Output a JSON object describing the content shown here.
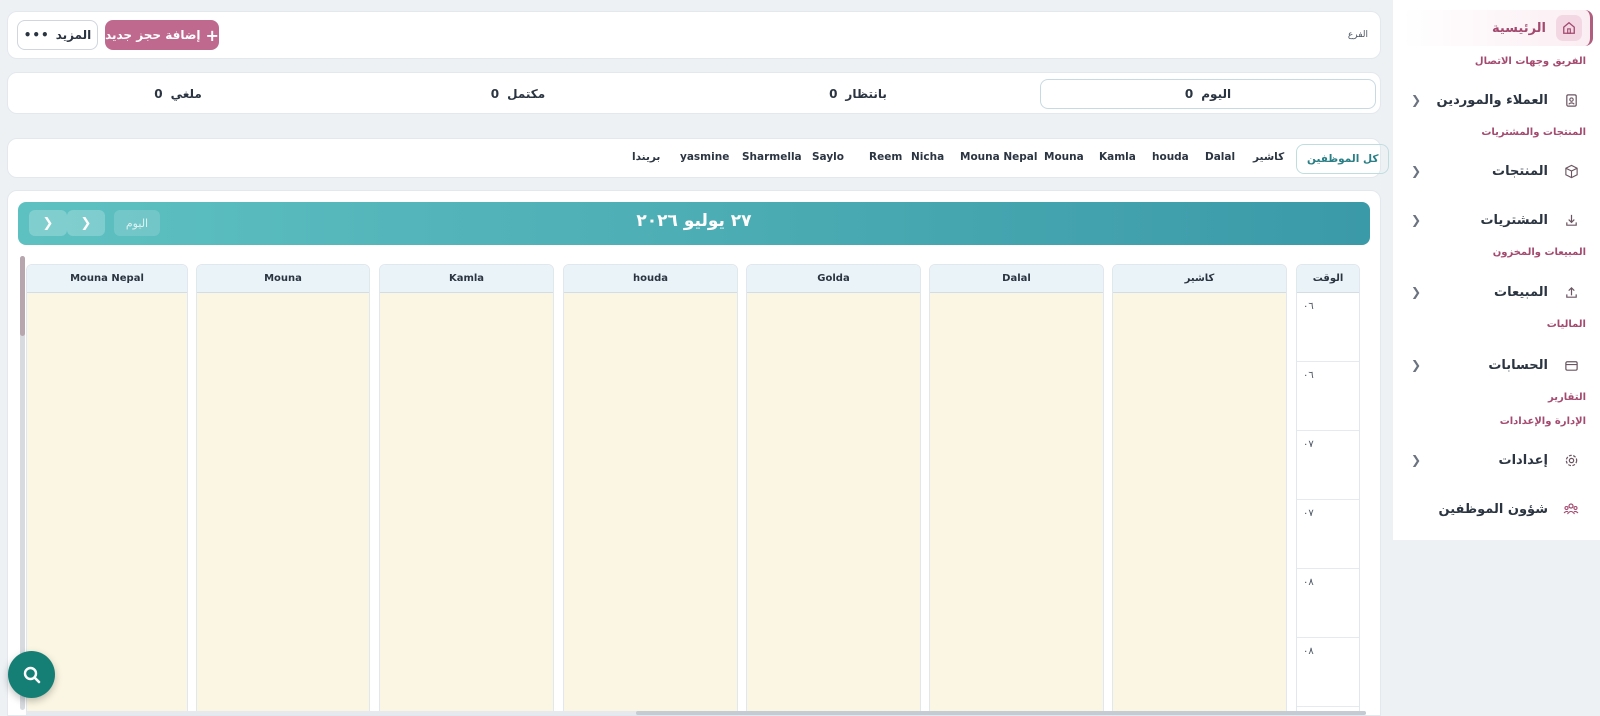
{
  "sidebar": {
    "active": {
      "label": "الرئيسية"
    },
    "sections": {
      "team": "الفريق وجهات الاتصال",
      "products": "المنتجات والمشتريات",
      "sales": "المبيعات والمخزون",
      "finance": "الماليات",
      "reports": "التقارير",
      "admin": "الإدارة والإعدادات"
    },
    "items": {
      "customers": "العملاء والموردين",
      "products": "المنتجات",
      "purchases": "المشتريات",
      "sales": "المبيعات",
      "accounts": "الحسابات",
      "settings": "إعدادات",
      "hr": "شؤون الموظفين"
    }
  },
  "toolbar": {
    "branch_label": "الفرع",
    "add_label": "إضافة حجز جديد",
    "more_label": "المزيد"
  },
  "stats": {
    "today": {
      "label": "اليوم",
      "value": "0"
    },
    "waiting": {
      "label": "بانتظار",
      "value": "0"
    },
    "completed": {
      "label": "مكتمل",
      "value": "0"
    },
    "cancelled": {
      "label": "ملغي",
      "value": "0"
    }
  },
  "tabs": {
    "all": "كل الموظفين",
    "t1": "كاشير",
    "t2": "Dalal",
    "t3": "houda",
    "t4": "Kamla",
    "t5": "Mouna",
    "t6": "Mouna Nepal",
    "t7": "Nicha",
    "t8": "Reem",
    "t9": "Saylo",
    "t10": "Sharmella",
    "t11": "yasmine",
    "t12": "بريندا"
  },
  "calendar": {
    "title": "٢٧ يوليو ٢٠٢٦",
    "today_label": "اليوم",
    "time_header": "الوقت",
    "columns": {
      "c1": "كاشير",
      "c2": "Dalal",
      "c3": "Golda",
      "c4": "houda",
      "c5": "Kamla",
      "c6": "Mouna",
      "c7": "Mouna Nepal"
    },
    "slots": {
      "s1": "٠٦",
      "s2": "٠٦",
      "s3": "٠٧",
      "s4": "٠٧",
      "s5": "٠٨",
      "s6": "٠٨"
    }
  },
  "colors": {
    "brand": "#c0698f",
    "accent": "#157f76",
    "header_gradient_start": "#5ec1c1",
    "header_gradient_end": "#3b9aa8",
    "column_bg": "#fbf6e3"
  }
}
